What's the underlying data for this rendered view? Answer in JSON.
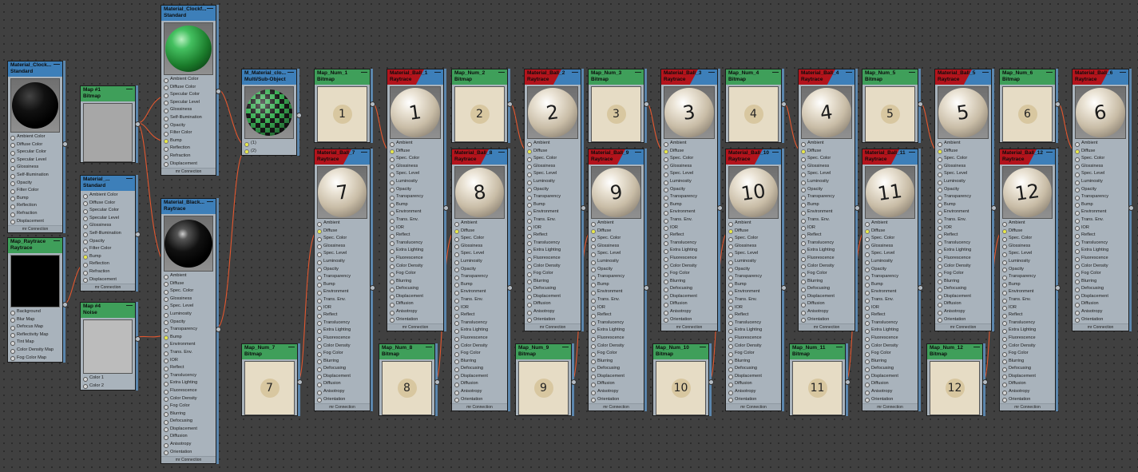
{
  "footer_label": "mr Connection",
  "colors": {
    "background": "#404040",
    "wire": "#e2572f",
    "material_header": "#3d7fb9",
    "map_header": "#3f9f5a",
    "raytrace_tag": "#b3141c"
  },
  "nodes": {
    "mat_clock_std": {
      "title": "Material_Clock...",
      "type": "Standard",
      "rows": [
        "Ambient Color",
        "Diffuse Color",
        "Specular Color",
        "Specular Level",
        "Glossiness",
        "Self-Illumination",
        "Opacity",
        "Filter Color",
        "Bump",
        "Reflection",
        "Refraction",
        "Displacement"
      ]
    },
    "map_raytrace": {
      "title": "Map_Raytrace",
      "type": "Raytrace",
      "rows": [
        "Background",
        "Blur Map",
        "Defocus Map",
        "Reflectivity Map",
        "Tint Map",
        "Color Density Map",
        "Fog Color Map"
      ]
    },
    "map1": {
      "title": "Map #1",
      "type": "Bitmap"
    },
    "map4": {
      "title": "Map #4",
      "type": "Noise",
      "rows": [
        "Color 1",
        "Color 2"
      ]
    },
    "mat_small_std": {
      "title": "Material_...",
      "type": "Standard",
      "rows": [
        "Ambient Color",
        "Diffuse Color",
        "Specular Color",
        "Specular Level",
        "Glossiness",
        "Self-Illumination",
        "Opacity",
        "Filter Color",
        "Bump",
        "Reflection",
        "Refraction",
        "Displacement"
      ]
    },
    "mat_clock_std2": {
      "title": "Material_Clockf...",
      "type": "Standard",
      "rows": [
        "Ambient Color",
        "Diffuse Color",
        "Specular Color",
        "Specular Level",
        "Glossiness",
        "Self-Illumination",
        "Opacity",
        "Filter Color",
        "Bump",
        "Reflection",
        "Refraction",
        "Displacement"
      ]
    },
    "mat_black": {
      "title": "Material_Black...",
      "type": "Raytrace",
      "rows": [
        "Ambient",
        "Diffuse",
        "Spec. Color",
        "Glossiness",
        "Spec. Level",
        "Luminosity",
        "Opacity",
        "Transparency",
        "Bump",
        "Environment",
        "Trans. Env.",
        "IOR",
        "Reflect",
        "Translucency",
        "Extra Lighting",
        "Fluorescence",
        "Color Density",
        "Fog Color",
        "Blurring",
        "Defocusing",
        "Displacement",
        "Diffusion",
        "Anisotropy",
        "Orientation"
      ]
    },
    "multi_sub": {
      "title": "M_Material_clo...",
      "type": "Multi/Sub-Object",
      "rows": [
        "(1)",
        "(2)"
      ]
    }
  },
  "map_nums": [
    {
      "title": "Map_Num_1",
      "type": "Bitmap",
      "digit": "1"
    },
    {
      "title": "Map_Num_2",
      "type": "Bitmap",
      "digit": "2"
    },
    {
      "title": "Map_Num_3",
      "type": "Bitmap",
      "digit": "3"
    },
    {
      "title": "Map_Num_4",
      "type": "Bitmap",
      "digit": "4"
    },
    {
      "title": "Map_Num_5",
      "type": "Bitmap",
      "digit": "5"
    },
    {
      "title": "Map_Num_6",
      "type": "Bitmap",
      "digit": "6"
    },
    {
      "title": "Map_Num_7",
      "type": "Bitmap",
      "digit": "7"
    },
    {
      "title": "Map_Num_8",
      "type": "Bitmap",
      "digit": "8"
    },
    {
      "title": "Map_Num_9",
      "type": "Bitmap",
      "digit": "9"
    },
    {
      "title": "Map_Num_10",
      "type": "Bitmap",
      "digit": "10"
    },
    {
      "title": "Map_Num_11",
      "type": "Bitmap",
      "digit": "11"
    },
    {
      "title": "Map_Num_12",
      "type": "Bitmap",
      "digit": "12"
    }
  ],
  "ray_mats": [
    {
      "title": "Material_Ball_1",
      "type": "Raytrace",
      "digit": "1"
    },
    {
      "title": "Material_Ball_2",
      "type": "Raytrace",
      "digit": "2"
    },
    {
      "title": "Material_Ball_3",
      "type": "Raytrace",
      "digit": "3"
    },
    {
      "title": "Material_Ball_4",
      "type": "Raytrace",
      "digit": "4"
    },
    {
      "title": "Material_Ball_5",
      "type": "Raytrace",
      "digit": "5"
    },
    {
      "title": "Material_Ball_6",
      "type": "Raytrace",
      "digit": "6"
    },
    {
      "title": "Material_Ball_7",
      "type": "Raytrace",
      "digit": "7"
    },
    {
      "title": "Material_Ball_8",
      "type": "Raytrace",
      "digit": "8"
    },
    {
      "title": "Material_Ball_9",
      "type": "Raytrace",
      "digit": "9"
    },
    {
      "title": "Material_Ball_10",
      "type": "Raytrace",
      "digit": "10"
    },
    {
      "title": "Material_Ball_11",
      "type": "Raytrace",
      "digit": "11"
    },
    {
      "title": "Material_Ball_12",
      "type": "Raytrace",
      "digit": "12"
    }
  ],
  "raytrace_rows": [
    "Ambient",
    "Diffuse",
    "Spec. Color",
    "Glossiness",
    "Spec. Level",
    "Luminosity",
    "Opacity",
    "Transparency",
    "Bump",
    "Environment",
    "Trans. Env.",
    "IOR",
    "Reflect",
    "Translucency",
    "Extra Lighting",
    "Fluorescence",
    "Color Density",
    "Fog Color",
    "Blurring",
    "Defocusing",
    "Displacement",
    "Diffusion",
    "Anisotropy",
    "Orientation"
  ]
}
